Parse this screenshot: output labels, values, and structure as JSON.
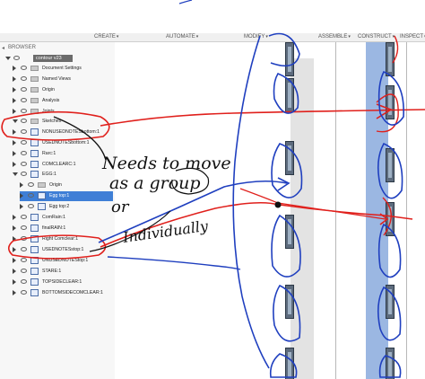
{
  "toolbar": {
    "create": "CREATE",
    "automate": "AUTOMATE",
    "modify": "MODIFY",
    "assemble": "ASSEMBLE",
    "construct": "CONSTRUCT",
    "inspect": "INSPECT",
    "dropdown_glyph": "▾"
  },
  "browser": {
    "title": "BROWSER",
    "root": "contour v23",
    "items": [
      {
        "label": "Document Settings"
      },
      {
        "label": "Named Views"
      },
      {
        "label": "Origin"
      },
      {
        "label": "Analysis"
      },
      {
        "label": "Joints"
      },
      {
        "label": "Sketches"
      },
      {
        "label": "NONUSEDNOTESbottom:1"
      },
      {
        "label": "USEDNOTESbottom:1"
      },
      {
        "label": "Rarc:1"
      },
      {
        "label": "COMCLEARC:1"
      },
      {
        "label": "EGG:1"
      },
      {
        "label": "Origin"
      },
      {
        "label": "Egg top:1"
      },
      {
        "label": "Egg top:2"
      },
      {
        "label": "ComRain:1"
      },
      {
        "label": "finalRAIN:1"
      },
      {
        "label": "Right Comclear:1"
      },
      {
        "label": "USEDNOTESstop:1"
      },
      {
        "label": "UNUSEDNOTEStop:1"
      },
      {
        "label": "STARE:1"
      },
      {
        "label": "TOPSIDECLEAR:1"
      },
      {
        "label": "BOTTOMSIDECOMCLEAR:1"
      }
    ]
  },
  "annotation": {
    "line1": "Needs to move",
    "line2": "as a group",
    "line3": "or",
    "line4": "Individually",
    "colors": {
      "red": "#e0201c",
      "blue": "#1f3fbf",
      "black": "#111111"
    }
  }
}
